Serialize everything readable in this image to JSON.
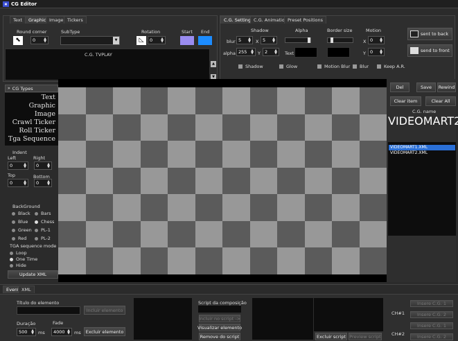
{
  "window": {
    "title": "CG Editor"
  },
  "top_tabs": [
    "Text",
    "Graphic",
    "Image",
    "Tickers"
  ],
  "top_tabs_active": 1,
  "graphic": {
    "round_corner_label": "Round corner",
    "round_corner_value": "0",
    "subtype_label": "SubType",
    "subtype_value": "",
    "rotation_label": "Rotation",
    "rotation_value": "0",
    "start_label": "Start",
    "end_label": "End",
    "start_color": "#9a8cf0",
    "end_color": "#1c8cff",
    "preview_text": "C.G. TVPLAY"
  },
  "settings_tabs": [
    "C.G. Settings",
    "C.G. Animation",
    "Preset Positions"
  ],
  "settings_tabs_active": 0,
  "settings": {
    "shadow_label": "Shadow",
    "alpha_label": "Alpha",
    "border_size_label": "Border size",
    "motion_label": "Motion",
    "blur_label": "blur",
    "blur_value": "5",
    "x_label": "X",
    "shadow_x": "5",
    "alpha_small_label": "alpha",
    "alpha_value": "255",
    "y_label": "Y",
    "shadow_y": "2",
    "text_label": "Text",
    "motion_x_label": "X",
    "motion_x": "0",
    "motion_y_label": "Y",
    "motion_y": "0",
    "alpha_slider": 0.45,
    "border_slider": 0.05,
    "sent_to_back": "sent to back",
    "send_to_front": "send to front",
    "checks": [
      "Shadow",
      "Glow",
      "Motion Blur",
      "Blur",
      "Keep A.R."
    ]
  },
  "cg_types": {
    "header": "CG Types",
    "items": [
      "Text",
      "Graphic",
      "Image",
      "Crawl Ticker",
      "Roll Ticker",
      "Tga Sequence"
    ]
  },
  "indent": {
    "label": "Indent",
    "left_label": "Left",
    "right_label": "Right",
    "top_label": "Top",
    "bottom_label": "Bottom",
    "left": "0",
    "right": "0",
    "top": "0",
    "bottom": "0"
  },
  "background": {
    "label": "BackGround",
    "options": [
      "Black",
      "Bars",
      "Blue",
      "Chess",
      "Green",
      "PL-1",
      "Red",
      "PL-2"
    ],
    "selected": "Chess"
  },
  "tga_mode": {
    "label": "TGA sequence mode",
    "options": [
      "Loop",
      "One Time",
      "Hide"
    ],
    "selected": "One Time"
  },
  "update_xml": "Update XML",
  "right_panel": {
    "del": "Del",
    "save": "Save",
    "rewind": "Rewind",
    "clear_item": "Clear item",
    "clear_all": "Clear All",
    "cg_name_label": "C.G. name",
    "cg_name_value": "VIDEOMART2",
    "files": [
      "VIDEOMART1.XML",
      "VIDEOMART2.XML"
    ],
    "selected_file": 0
  },
  "bottom_tabs": [
    "Events",
    "XML"
  ],
  "bottom_tabs_active": 0,
  "events": {
    "titulo_label": "Título do elemento",
    "titulo_value": "",
    "incluir_elemento": "Incluir elemento",
    "duracao_label": "Duração",
    "duracao_value": "500",
    "fade_label": "Fade",
    "fade_value": "4000",
    "ms1": "ms",
    "ms2": "ms",
    "excluir_elemento": "Excluir elemento",
    "script_label": "Script da composição",
    "incluir_script": "Incluir no script ->",
    "visualizar": "Visualizar elemento",
    "remove_script": "Remove do script",
    "excluir_script": "Excluir script",
    "preview_script": "Preview script",
    "ch1": "CH#1",
    "ch2": "CH#2",
    "insere": [
      "Insere C.G. 1",
      "Insere C.G. 2",
      "Insere C.G. 1",
      "Insere C.G. 2"
    ]
  }
}
